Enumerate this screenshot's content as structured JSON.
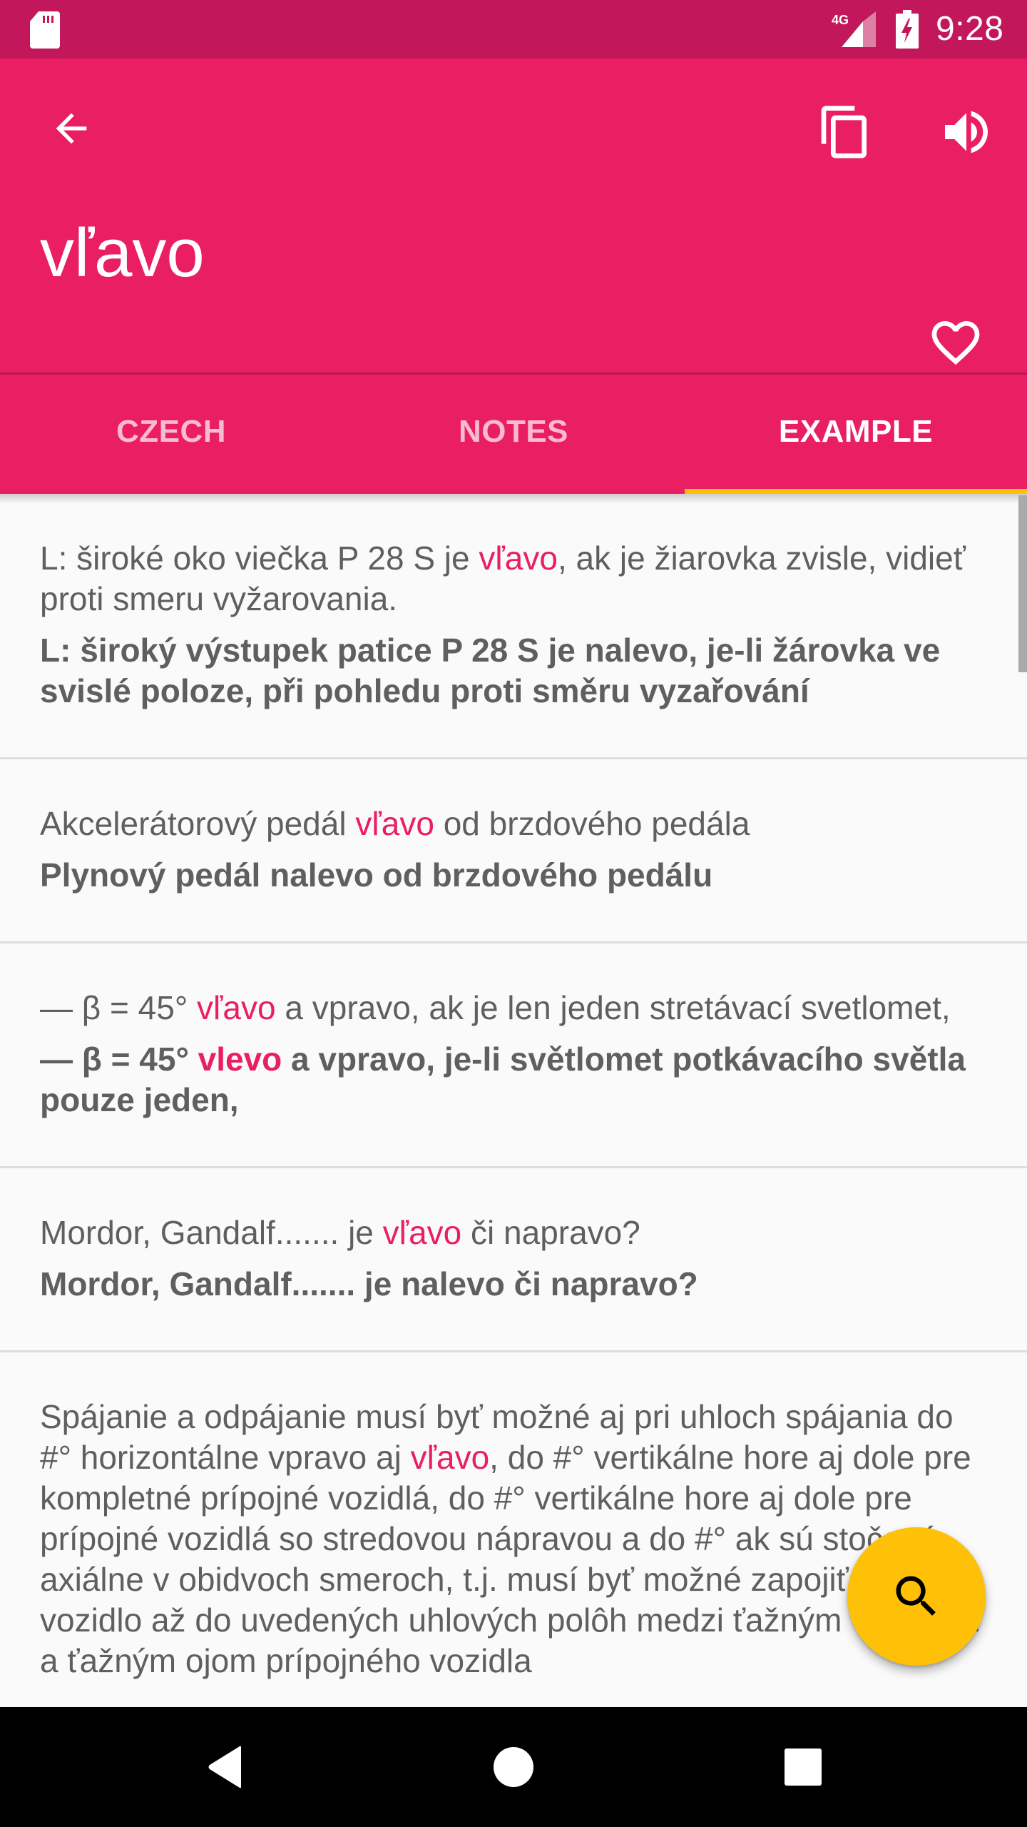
{
  "status_bar": {
    "time": "9:28",
    "network_label": "4G",
    "icons": [
      "sd-card-icon",
      "signal-4g-icon",
      "battery-charging-icon"
    ]
  },
  "app_bar": {
    "word": "vľavo",
    "icons": {
      "back": "arrow-back-icon",
      "copy": "copy-icon",
      "speak": "volume-icon",
      "favorite": "heart-outline-icon"
    }
  },
  "tabs": [
    {
      "label": "CZECH",
      "active": false
    },
    {
      "label": "NOTES",
      "active": false
    },
    {
      "label": "EXAMPLE",
      "active": true
    }
  ],
  "colors": {
    "primary": "#E91E63",
    "primary_dark": "#C2185B",
    "accent": "#FFC107",
    "highlight_text": "#E91E63",
    "body_text": "#5F5F5F",
    "inactive_tab": "#F8BBD0"
  },
  "examples": [
    {
      "source": {
        "before": "L: široké oko viečka P 28 S je ",
        "highlight": "vľavo",
        "after": ", ak je žiarovka zvisle, vidieť proti smeru vyžarovania."
      },
      "translation": {
        "before": "L: široký výstupek patice P 28 S je nalevo, je-li žárovka ve svislé poloze, při pohledu proti směru vyzařování",
        "highlight": "",
        "after": ""
      }
    },
    {
      "source": {
        "before": "Akcelerátorový pedál ",
        "highlight": "vľavo",
        "after": " od brzdového pedála"
      },
      "translation": {
        "before": "Plynový pedál nalevo od brzdového pedálu",
        "highlight": "",
        "after": ""
      }
    },
    {
      "source": {
        "before": "— β = 45° ",
        "highlight": "vľavo",
        "after": " a vpravo, ak je len jeden stretávací svetlomet,"
      },
      "translation": {
        "before": "— β = 45° ",
        "highlight": "vlevo",
        "after": " a vpravo, je-li světlomet potkávacího světla pouze jeden,"
      }
    },
    {
      "source": {
        "before": "Mordor, Gandalf....... je ",
        "highlight": "vľavo",
        "after": " či napravo?"
      },
      "translation": {
        "before": "Mordor, Gandalf....... je nalevo či napravo?",
        "highlight": "",
        "after": ""
      }
    },
    {
      "source": {
        "before": "Spájanie a odpájanie musí byť možné aj pri uhloch spájania do #° horizontálne vpravo aj ",
        "highlight": "vľavo",
        "after": ", do #° vertikálne hore aj dole pre kompletné prípojné vozidlá, do #° vertikálne hore aj dole pre prípojné vozidlá so stredovou nápravou a do #° ak sú stočené axiálne v obidvoch smeroch, t.j. musí byť možné zapojiť prípojné vozidlo až do uvedených uhlových polôh medzi ťažným vozidlom a ťažným ojom prípojného vozidla"
      },
      "translation": {
        "before": "",
        "highlight": "",
        "after": ""
      }
    }
  ],
  "fab": {
    "icon": "search-icon",
    "label": "Search"
  },
  "nav_bar": {
    "icons": [
      "nav-back-icon",
      "nav-home-icon",
      "nav-recents-icon"
    ]
  }
}
